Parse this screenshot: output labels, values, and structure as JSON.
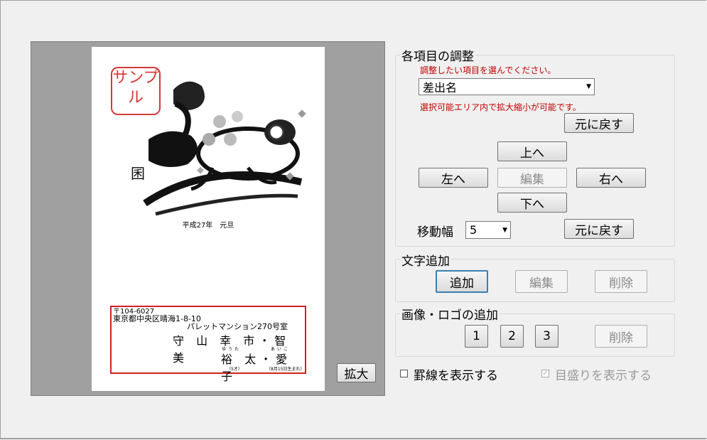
{
  "preview": {
    "sample_stamp": "サンプル",
    "date_line": "平成27年　元旦",
    "address": {
      "postal": "〒104-6027",
      "line1": "東京都中央区晴海1-8-10",
      "line2": "パレットマンション270号室",
      "names_row1": "守 山 幸 市・智 美",
      "names_row2": "裕 太・愛 子",
      "ruby_yuta": "ゆうた",
      "ruby_aiko": "あいこ",
      "note_age": "（5才）",
      "note_birth": "（8月15日生まれ）"
    },
    "zoom_button": "拡大"
  },
  "adjust": {
    "title": "各項目の調整",
    "hint": "調整したい項目を選んでください。",
    "select_value": "差出名",
    "hint2": "選択可能エリア内で拡大縮小が可能です。",
    "reset_label": "元に戻す",
    "up": "上へ",
    "left": "左へ",
    "edit": "編集",
    "right": "右へ",
    "down": "下へ",
    "step_label": "移動幅",
    "step_value": "5",
    "reset2_label": "元に戻す"
  },
  "text_add": {
    "title": "文字追加",
    "add": "追加",
    "edit": "編集",
    "delete": "削除"
  },
  "image_add": {
    "title": "画像・ロゴの追加",
    "b1": "1",
    "b2": "2",
    "b3": "3",
    "delete": "削除"
  },
  "options": {
    "show_lines": "罫線を表示する",
    "show_ruler": "目盛りを表示する"
  }
}
